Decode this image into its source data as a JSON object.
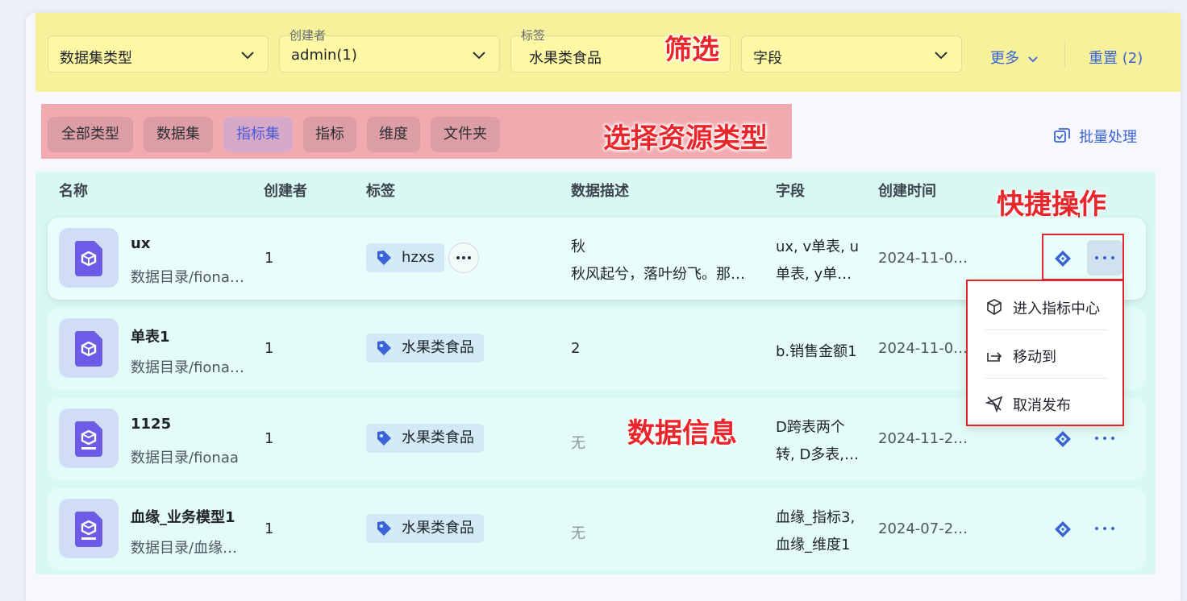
{
  "filters": {
    "dataset_type": {
      "value": "数据集类型"
    },
    "creator": {
      "label": "创建者",
      "value": "admin(1)"
    },
    "tag": {
      "label": "标签",
      "value": "水果类食品"
    },
    "field": {
      "value": "字段"
    },
    "more_label": "更多",
    "reset_label": "重置 (2)"
  },
  "annotations": {
    "filter": "筛选",
    "resource_type": "选择资源类型",
    "quick_action": "快捷操作",
    "data_info": "数据信息"
  },
  "type_tabs": [
    "全部类型",
    "数据集",
    "指标集",
    "指标",
    "维度",
    "文件夹"
  ],
  "active_type": "指标集",
  "batch_label": "批量处理",
  "table": {
    "columns": [
      "名称",
      "创建者",
      "标签",
      "数据描述",
      "字段",
      "创建时间"
    ],
    "rows": [
      {
        "name": "ux",
        "path": "数据目录/fiona…",
        "creator": "1",
        "tag": "hzxs",
        "desc_line1": "秋",
        "desc_line2": "秋风起兮，落叶纷飞。那…",
        "fields_line1": "ux, v单表, u",
        "fields_line2": "单表, y单…",
        "created": "2024-11-0…"
      },
      {
        "name": "单表1",
        "path": "数据目录/fiona…",
        "creator": "1",
        "tag": "水果类食品",
        "desc_line1": "2",
        "desc_line2": "",
        "fields_line1": "b.销售金额1",
        "fields_line2": "",
        "created": "2024-11-0…"
      },
      {
        "name": "1125",
        "path": "数据目录/fionaa",
        "creator": "1",
        "tag": "水果类食品",
        "desc_line1": "无",
        "desc_line2": "",
        "fields_line1": "D跨表两个",
        "fields_line2": "转, D多表,…",
        "created": "2024-11-2…"
      },
      {
        "name": "血缘_业务模型1",
        "path": "数据目录/血缘…",
        "creator": "1",
        "tag": "水果类食品",
        "desc_line1": "无",
        "desc_line2": "",
        "fields_line1": "血缘_指标3,",
        "fields_line2": "血缘_维度1",
        "created": "2024-07-2…"
      }
    ]
  },
  "context_menu": {
    "items": [
      {
        "label": "进入指标中心",
        "icon": "cube-icon"
      },
      {
        "label": "移动到",
        "icon": "move-icon"
      },
      {
        "label": "取消发布",
        "icon": "unpublish-icon"
      }
    ]
  },
  "colors": {
    "accent": "#3a63d8",
    "annotation_red": "#e8262c",
    "filter_highlight": "#f6f19a",
    "type_highlight": "#f1aab0",
    "table_highlight": "#d8f8f2"
  }
}
